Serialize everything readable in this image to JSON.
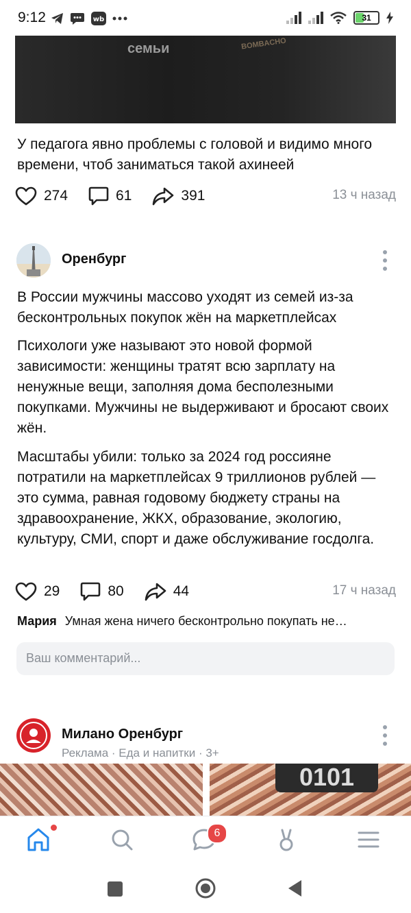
{
  "status_bar": {
    "time": "9:12",
    "battery": "31"
  },
  "video": {
    "overlay_word": "семьи",
    "logo_text": "BOMBACHO"
  },
  "post1": {
    "text": "У педагога явно проблемы с головой и видимо много времени, чтоб заниматься такой ахинеей",
    "likes": "274",
    "comments": "61",
    "shares": "391",
    "time": "13 ч назад"
  },
  "post2": {
    "author": "Оренбург",
    "paragraph1": "В России мужчины массово уходят из семей из-за бесконтрольных покупок жён на маркетплейсах",
    "paragraph2": "Психологи уже называют это новой формой зависимости: женщины тратят всю зарплату на ненужные вещи, заполняя дома бесполезными покупками. Мужчины не выдерживают и бросают своих жён.",
    "paragraph3": "Масштабы убили: только за 2024 год россияне потратили на маркетплейсах 9 триллионов рублей — это сумма, равная годовому бюджету страны на здравоохранение, ЖКХ, образование, экологию, культуру, СМИ, спорт и даже обслуживание госдолга.",
    "likes": "29",
    "comments": "80",
    "shares": "44",
    "time": "17 ч назад",
    "top_comment": {
      "author": "Мария",
      "text": "Умная жена ничего бесконтрольно покупать не…"
    },
    "comment_placeholder": "Ваш комментарий..."
  },
  "post3": {
    "author": "Милано Оренбург",
    "subtitle": "Реклама · Еда и напитки · 3+",
    "image_text": "0101"
  },
  "tabbar": {
    "messages_badge": "6"
  },
  "colors": {
    "accent": "#2688eb",
    "badge": "#e64646",
    "muted": "#8a8f96"
  }
}
